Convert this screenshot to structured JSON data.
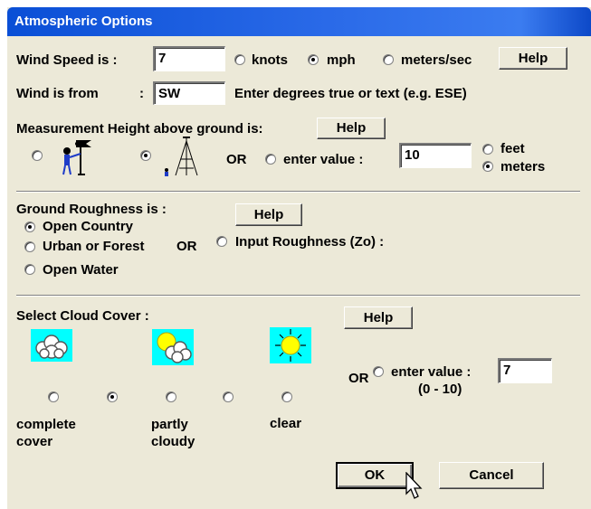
{
  "window": {
    "title": "Atmospheric Options"
  },
  "wind": {
    "speed_label": "Wind Speed is :",
    "speed_value": "7",
    "units": [
      {
        "label": "knots",
        "selected": false
      },
      {
        "label": "mph",
        "selected": true
      },
      {
        "label": "meters/sec",
        "selected": false
      }
    ],
    "help_label": "Help",
    "from_label": "Wind is from",
    "from_colon": ":",
    "from_value": "SW",
    "from_hint": "Enter degrees true or text (e.g. ESE)"
  },
  "height": {
    "label": "Measurement Height above ground is:",
    "help_label": "Help",
    "options": [
      {
        "icon": "anemometer-person-icon",
        "selected": false
      },
      {
        "icon": "tower-icon",
        "selected": true
      }
    ],
    "or_label": "OR",
    "enter_value_label": "enter value :",
    "enter_selected": false,
    "value": "10",
    "units": [
      {
        "label": "feet",
        "selected": false
      },
      {
        "label": "meters",
        "selected": true
      }
    ]
  },
  "roughness": {
    "label": "Ground Roughness is :",
    "help_label": "Help",
    "options": [
      {
        "label": "Open Country",
        "selected": true
      },
      {
        "label": "Urban or Forest",
        "selected": false
      },
      {
        "label": "Open Water",
        "selected": false
      }
    ],
    "or_label": "OR",
    "input_label": "Input Roughness (Zo) :",
    "input_selected": false
  },
  "cloud": {
    "label": "Select Cloud Cover :",
    "help_label": "Help",
    "icons": [
      "cloud-icon",
      "partly-cloudy-icon",
      "sun-icon"
    ],
    "radios": [
      false,
      true,
      false,
      false,
      false
    ],
    "captions": [
      {
        "line1": "complete",
        "line2": "cover"
      },
      {
        "line1": "partly",
        "line2": "cloudy"
      },
      {
        "line1": "clear",
        "line2": ""
      }
    ],
    "or_label": "OR",
    "enter_value_label": "enter value :",
    "enter_selected": false,
    "value": "7",
    "range_label": "(0 - 10)"
  },
  "buttons": {
    "ok": "OK",
    "cancel": "Cancel"
  },
  "colors": {
    "title_bar": "#0a4fd6",
    "dialog_bg": "#ece9d8",
    "icon_bg": "#00ffff"
  }
}
